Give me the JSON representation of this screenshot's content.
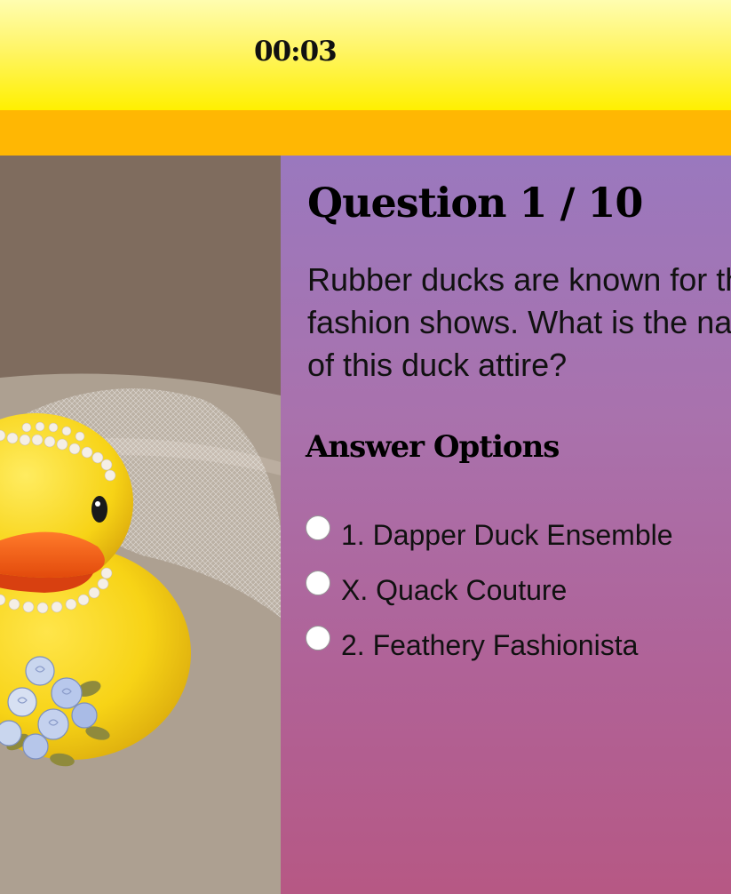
{
  "quiz": {
    "timer": "00:03",
    "question_title": "Question 1 / 10",
    "question_text": "Rubber ducks are known for their fashion shows. What is the name of this duck attire?",
    "answer_heading": "Answer Options",
    "options": [
      {
        "label": "1.  Dapper Duck Ensemble"
      },
      {
        "label": "X.  Quack Couture"
      },
      {
        "label": "2.  Feathery Fashionista"
      }
    ]
  },
  "image": {
    "subject": "rubber-duck-bride"
  },
  "colors": {
    "top_bar": "#fff000",
    "band": "#ffb703",
    "panel_top": "#9a78be",
    "panel_bottom": "#b65884",
    "duck": "#f7d316",
    "beak": "#f25a14"
  }
}
